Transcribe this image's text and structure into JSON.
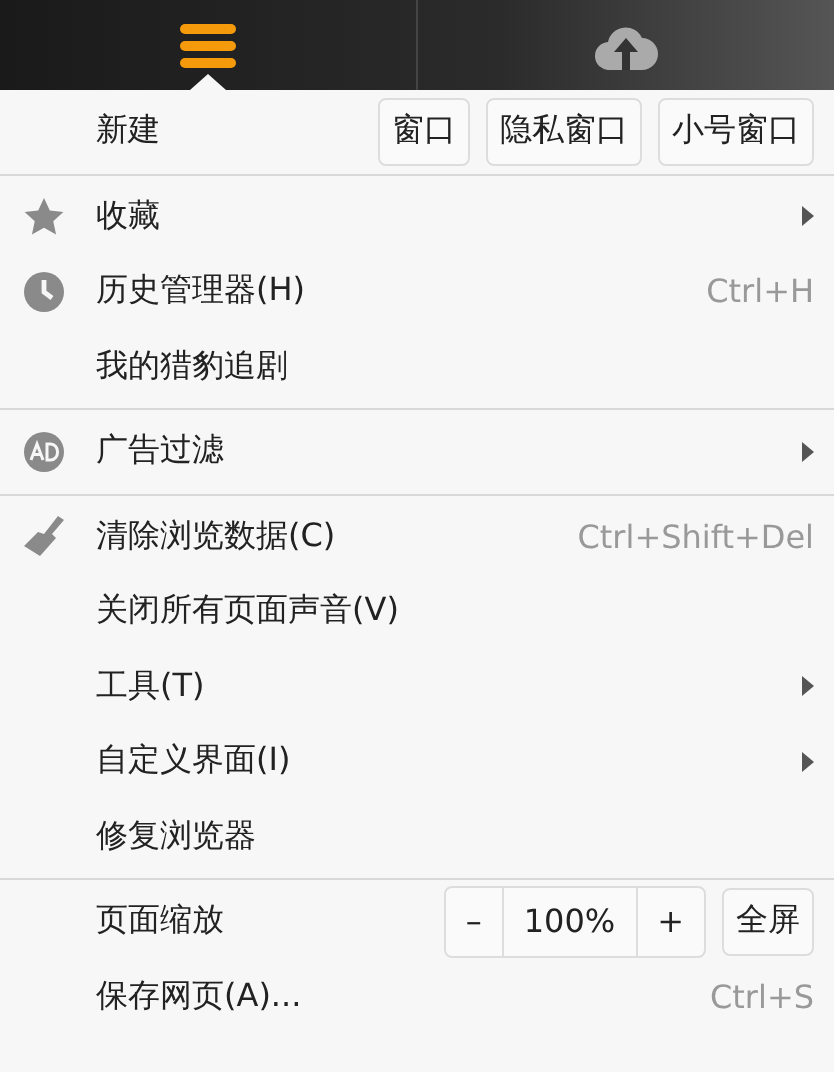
{
  "toolbar": [
    {
      "selected": true
    },
    {
      "selected": false
    }
  ],
  "sections": [
    [
      {
        "kind": "buttons",
        "label": "新建",
        "buttons": [
          "窗口",
          "隐私窗口",
          "小号窗口"
        ]
      }
    ],
    [
      {
        "kind": "item",
        "label": "收藏",
        "submenu": true
      },
      {
        "kind": "item",
        "label": "历史管理器(H)",
        "shortcut": "Ctrl+H"
      },
      {
        "kind": "item",
        "label": "我的猎豹追剧"
      }
    ],
    [
      {
        "kind": "item",
        "label": "广告过滤",
        "submenu": true
      }
    ],
    [
      {
        "kind": "item",
        "label": "清除浏览数据(C)",
        "shortcut": "Ctrl+Shift+Del"
      },
      {
        "kind": "item",
        "label": "关闭所有页面声音(V)"
      },
      {
        "kind": "item",
        "label": "工具(T)",
        "submenu": true
      },
      {
        "kind": "item",
        "label": "自定义界面(I)",
        "submenu": true
      },
      {
        "kind": "item",
        "label": "修复浏览器"
      }
    ],
    [
      {
        "kind": "zoom",
        "label": "页面缩放",
        "minus": "–",
        "value": "100%",
        "plus": "+",
        "fullscreen": "全屏"
      },
      {
        "kind": "item",
        "label": "保存网页(A)...",
        "shortcut": "Ctrl+S"
      }
    ]
  ]
}
